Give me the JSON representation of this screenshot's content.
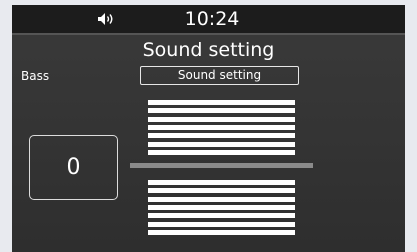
{
  "status_bar": {
    "time": "10:24",
    "volume_icon": "speaker-icon"
  },
  "screen": {
    "title": "Sound setting",
    "parameter_label": "Bass",
    "mode_button_label": "Sound setting",
    "value": "0",
    "level_segments": 14,
    "level_fraction": 0.5
  },
  "colors": {
    "background": "#333333",
    "status_bar": "#1c1c1c",
    "text": "#ffffff",
    "center_line": "#8a8a8a"
  }
}
